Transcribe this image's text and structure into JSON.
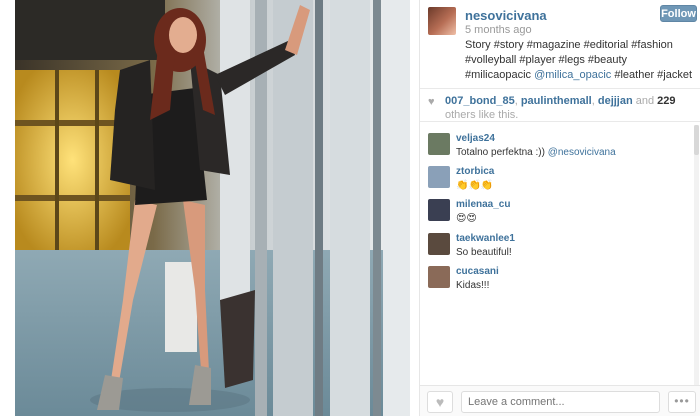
{
  "post": {
    "username": "nesovicivana",
    "time": "5 months ago",
    "follow_label": "Follow",
    "caption_text": "Story #story #magazine #editorial #fashion #volleyball #player #legs #beauty #milicaopacic ",
    "caption_mention": "@milica_opacic",
    "caption_tail": " #leather #jacket"
  },
  "likes": {
    "user1": "007_bond_85",
    "sep1": ", ",
    "user2": "paulinthemall",
    "sep2": ", ",
    "user3": "dejjjan",
    "and": " and ",
    "count": "229",
    "suffix": " others like this."
  },
  "comments": [
    {
      "user": "veljas24",
      "text": "Totalno perfektna :)) ",
      "mention": "@nesovicivana",
      "avatar_color": "#6b7a62"
    },
    {
      "user": "ztorbica",
      "text": "👏👏👏",
      "mention": "",
      "avatar_color": "#8aa0b8"
    },
    {
      "user": "milenaa_cu",
      "text": "😍😍",
      "mention": "",
      "avatar_color": "#3a3f52"
    },
    {
      "user": "taekwanlee1",
      "text": "So beautiful!",
      "mention": "",
      "avatar_color": "#5a4a3e"
    },
    {
      "user": "cucasani",
      "text": "Kidas!!!",
      "mention": "",
      "avatar_color": "#8a6a58"
    }
  ],
  "footer": {
    "comment_placeholder": "Leave a comment...",
    "more_label": "•••",
    "heart_icon": "heart-icon"
  },
  "colors": {
    "link": "#3f729b",
    "follow_bg": "#6f97b6"
  }
}
